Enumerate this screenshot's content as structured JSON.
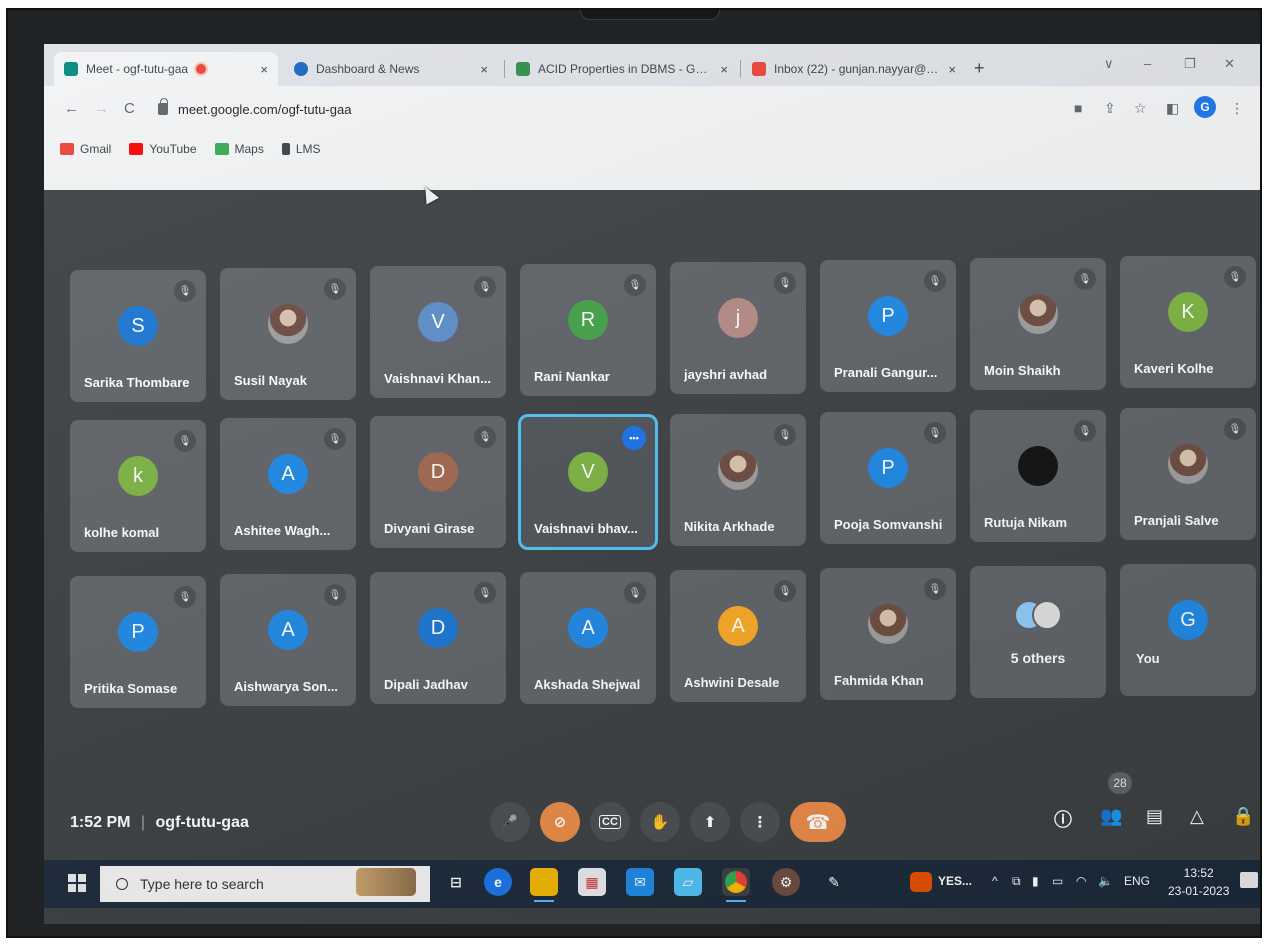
{
  "tabs": [
    {
      "label": "Meet - ogf-tutu-gaa",
      "close": "×"
    },
    {
      "label": "Dashboard & News",
      "close": "×"
    },
    {
      "label": "ACID Properties in DBMS - Geek",
      "close": "×"
    },
    {
      "label": "Inbox (22) - gunjan.nayyar@anu",
      "close": "×"
    }
  ],
  "new_tab": "+",
  "window_controls": {
    "minimize": "–",
    "restore": "❐",
    "close": "✕",
    "chevron": "∨"
  },
  "address": {
    "url": "meet.google.com/ogf-tutu-gaa"
  },
  "profile_initial": "G",
  "bookmarks": [
    {
      "label": "Gmail",
      "color": "#ea4335"
    },
    {
      "label": "YouTube",
      "color": "#ff0000"
    },
    {
      "label": "Maps",
      "color": "#34a853"
    },
    {
      "label": "LMS",
      "color": "#3c4043"
    }
  ],
  "participants": [
    {
      "name": "Sarika Thombare",
      "initial": "S",
      "color": "#1976d2"
    },
    {
      "name": "Susil Nayak",
      "initial": "",
      "color": "photo"
    },
    {
      "name": "Vaishnavi Khan...",
      "initial": "V",
      "color": "#5c8dc9"
    },
    {
      "name": "Rani Nankar",
      "initial": "R",
      "color": "#43a047"
    },
    {
      "name": "jayshri avhad",
      "initial": "j",
      "color": "#b58a86"
    },
    {
      "name": "Pranali Gangur...",
      "initial": "P",
      "color": "#1e88e5"
    },
    {
      "name": "Moin Shaikh",
      "initial": "",
      "color": "photo"
    },
    {
      "name": "Kaveri Kolhe",
      "initial": "K",
      "color": "#7cb342"
    },
    {
      "name": "kolhe komal",
      "initial": "k",
      "color": "#7cb342"
    },
    {
      "name": "Ashitee Wagh...",
      "initial": "A",
      "color": "#1e88e5"
    },
    {
      "name": "Divyani Girase",
      "initial": "D",
      "color": "#a0674f"
    },
    {
      "name": "Vaishnavi bhav...",
      "initial": "V",
      "color": "#7cb342"
    },
    {
      "name": "Nikita Arkhade",
      "initial": "",
      "color": "photo"
    },
    {
      "name": "Pooja Somvanshi",
      "initial": "P",
      "color": "#1e88e5"
    },
    {
      "name": "Rutuja Nikam",
      "initial": "",
      "color": "dark"
    },
    {
      "name": "Pranjali Salve",
      "initial": "",
      "color": "photo"
    },
    {
      "name": "Pritika Somase",
      "initial": "P",
      "color": "#1e88e5"
    },
    {
      "name": "Aishwarya Son...",
      "initial": "A",
      "color": "#1e88e5"
    },
    {
      "name": "Dipali Jadhav",
      "initial": "D",
      "color": "#1976d2"
    },
    {
      "name": "Akshada Shejwal",
      "initial": "A",
      "color": "#1e88e5"
    },
    {
      "name": "Ashwini Desale",
      "initial": "A",
      "color": "#f9a825"
    },
    {
      "name": "Fahmida Khan",
      "initial": "",
      "color": "photo"
    },
    {
      "name": "5 others",
      "initial": "",
      "color": "others"
    },
    {
      "name": "You",
      "initial": "G",
      "color": "#1e88e5"
    }
  ],
  "meeting": {
    "time": "1:52 PM",
    "separator": "|",
    "code": "ogf-tutu-gaa"
  },
  "controls": {
    "mic": "🎤",
    "camera_off": "⊘",
    "captions": "CC",
    "raise_hand": "✋",
    "present": "⬆",
    "more": "⋮",
    "leave": "☎"
  },
  "right_controls": {
    "info": "ⓘ",
    "people": "👥",
    "people_count": "28",
    "chat": "▤",
    "activities": "△",
    "host": "🔒"
  },
  "taskbar": {
    "search_placeholder": "Type here to search",
    "notification_text": "YES...",
    "tray_chevron": "^",
    "language": "ENG",
    "clock_time": "13:52",
    "clock_date": "23-01-2023"
  }
}
